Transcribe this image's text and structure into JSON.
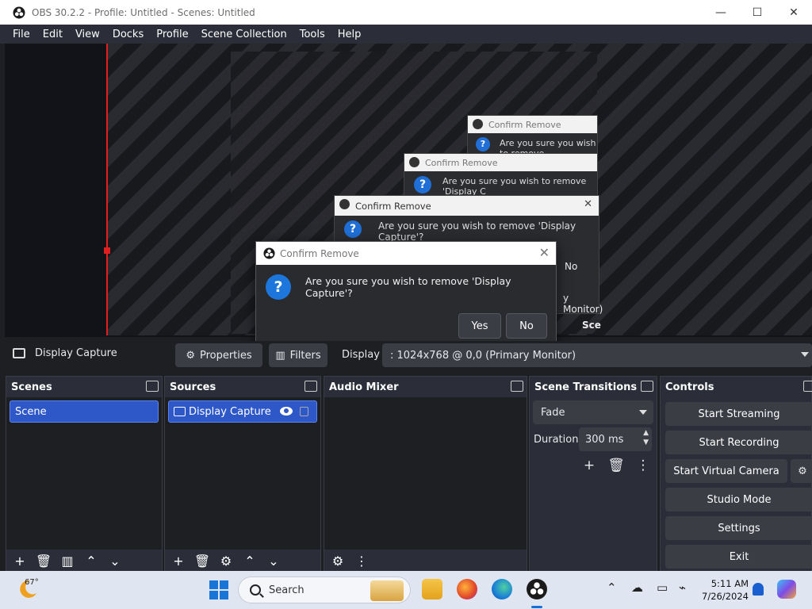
{
  "window": {
    "title": "OBS 30.2.2 - Profile: Untitled - Scenes: Untitled",
    "minimize": "—",
    "maximize": "☐",
    "close": "✕"
  },
  "menu": [
    "File",
    "Edit",
    "View",
    "Docks",
    "Profile",
    "Scene Collection",
    "Tools",
    "Help"
  ],
  "ghost_dialogs": [
    {
      "title": "Confirm Remove",
      "message": "Are you sure you wish to remove 'Display Capture'?",
      "no": "No",
      "tail": "y Monitor)",
      "tail2": "Sce"
    },
    {
      "title": "Confirm Remove",
      "message": "Are you sure you wish to remove 'Display C"
    },
    {
      "title": "Confirm Remove",
      "message": "Are you sure you wish to remove"
    }
  ],
  "dialog": {
    "title": "Confirm Remove",
    "message": "Are you sure you wish to remove 'Display Capture'?",
    "yes_label": "Yes",
    "no_label": "No"
  },
  "source_toolbar": {
    "source_name": "Display Capture",
    "properties_label": "Properties",
    "filters_label": "Filters",
    "display_label": "Display",
    "display_value": ": 1024x768 @ 0,0 (Primary Monitor)"
  },
  "docks": {
    "scenes": {
      "title": "Scenes",
      "items": [
        "Scene"
      ]
    },
    "sources": {
      "title": "Sources",
      "items": [
        "Display Capture"
      ]
    },
    "mixer": {
      "title": "Audio Mixer"
    },
    "transitions": {
      "title": "Scene Transitions",
      "transition": "Fade",
      "duration_label": "Duration",
      "duration_value": "300 ms"
    },
    "controls": {
      "title": "Controls",
      "start_streaming": "Start Streaming",
      "start_recording": "Start Recording",
      "start_virtual_camera": "Start Virtual Camera",
      "studio_mode": "Studio Mode",
      "settings": "Settings",
      "exit": "Exit"
    }
  },
  "taskbar": {
    "temperature": "67°",
    "search_placeholder": "Search",
    "time": "5:11 AM",
    "date": "7/26/2024"
  }
}
